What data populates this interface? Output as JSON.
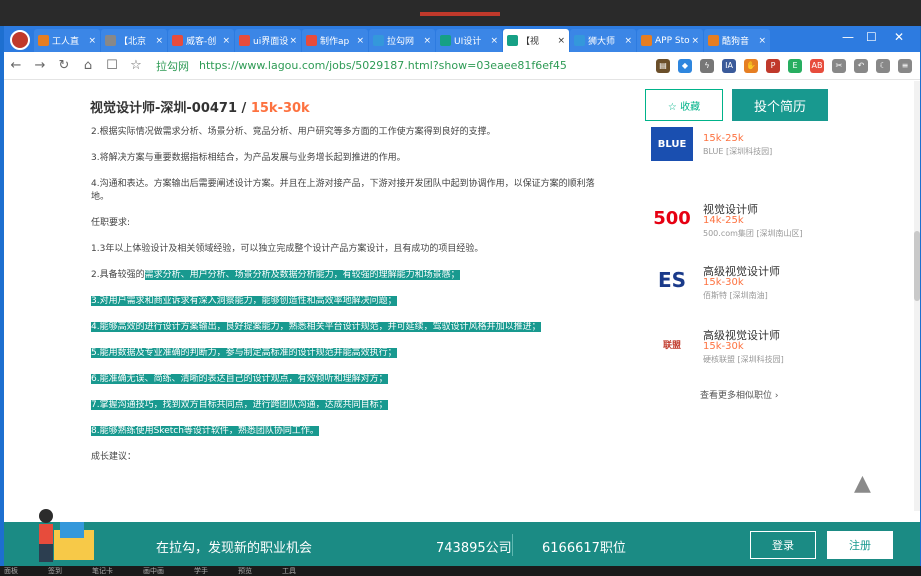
{
  "browser": {
    "tabs": [
      {
        "label": "工人直",
        "color": "#e67e22",
        "icon": "bird-icon"
      },
      {
        "label": "【北京",
        "color": "#888888",
        "icon": "hand-icon"
      },
      {
        "label": "威客-创",
        "color": "#e74c3c",
        "icon": "EP"
      },
      {
        "label": "ui界面设",
        "color": "#e74c3c",
        "icon": "EP"
      },
      {
        "label": "制作ap",
        "color": "#e74c3c",
        "icon": "EP"
      },
      {
        "label": "拉勾网",
        "color": "#3498db",
        "icon": "paw-icon"
      },
      {
        "label": "UI设计",
        "color": "#16a085",
        "icon": "L"
      },
      {
        "label": "【视",
        "color": "#16a085",
        "icon": "L",
        "active": true
      },
      {
        "label": "狮大师",
        "color": "#3498db",
        "icon": "paw-icon"
      },
      {
        "label": "APP Sto",
        "color": "#e67e22",
        "icon": "app-icon"
      },
      {
        "label": "酷狗音",
        "color": "#e67e22",
        "icon": "app-icon"
      }
    ],
    "site_name": "拉勾网",
    "url": "https://www.lagou.com/jobs/5029187.html?show=03eaee81f6ef45",
    "tab_close": "×",
    "window_controls": [
      "—",
      "☐",
      "✕"
    ]
  },
  "job": {
    "title": "视觉设计师-深圳-00471 / ",
    "salary": "15k-30k",
    "lines": [
      "2.根据实际情况做需求分析、场景分析、竞品分析、用户研究等多方面的工作使方案得到良好的支撑。",
      "3.将解决方案与重要数据指标相结合，为产品发展与业务增长起到推进的作用。",
      "4.沟通和表达。方案输出后需要阐述设计方案。并且在上游对接产品，下游对接开发团队中起到协调作用，以保证方案的顺利落地。",
      "任职要求:",
      "1.3年以上体验设计及相关领域经验，可以独立完成整个设计产品方案设计，且有成功的项目经验。"
    ],
    "hl_prefix": "2.具备较强的",
    "hl_lines": [
      "需求分析、用户分析、场景分析及数据分析能力，有较强的理解能力和场景感；",
      "3.对用户需求和商业诉求有深入洞察能力，能够创造性和高效率地解决问题；",
      "4.能够高效的进行设计方案输出，良好提案能力，熟悉相关平台设计规范，并可延续，驾驭设计风格并加以推进；",
      "5.能用数据及专业准确的判断力，参与制定高标准的设计规范并能高效执行；",
      "6.能准确无误、简练、清晰的表达自己的设计观点，有效倾听和理解对方；",
      "7.掌握沟通技巧，找到双方目标共同点，进行跨团队沟通，达成共同目标；",
      "8.能够熟练使用Sketch等设计软件，熟悉团队协同工作。"
    ],
    "growth": "成长建议："
  },
  "actions": {
    "collect": "☆ 收藏",
    "apply": "投个简历"
  },
  "similar": [
    {
      "logo": "BLUE",
      "title": "",
      "salary": "15k-25k",
      "company": "BLUE [深圳科技园]",
      "logo_color": "#1a4fb0"
    },
    {
      "logo": "500",
      "title": "视觉设计师",
      "salary": "14k-25k",
      "company": "500.com集团 [深圳南山区]",
      "logo_color": "#e60012"
    },
    {
      "logo": "ES",
      "title": "高级视觉设计师",
      "salary": "15k-30k",
      "company": "佰斯特 [深圳南油]",
      "logo_color": "#1a3a8a"
    },
    {
      "logo": "联盟",
      "title": "高级视觉设计师",
      "salary": "15k-30k",
      "company": "硬核联盟 [深圳科技园]",
      "logo_color": "#c0392b"
    }
  ],
  "more_similar": "查看更多相似职位",
  "banner": {
    "slogan": "在拉勾，发现新的职业机会",
    "companies": "743895公司",
    "jobs": "6166617职位",
    "login": "登录",
    "register": "注册"
  },
  "taskbar": [
    "面板",
    "签到",
    "笔记卡",
    "画中画",
    "学手",
    "预览",
    "工具"
  ]
}
